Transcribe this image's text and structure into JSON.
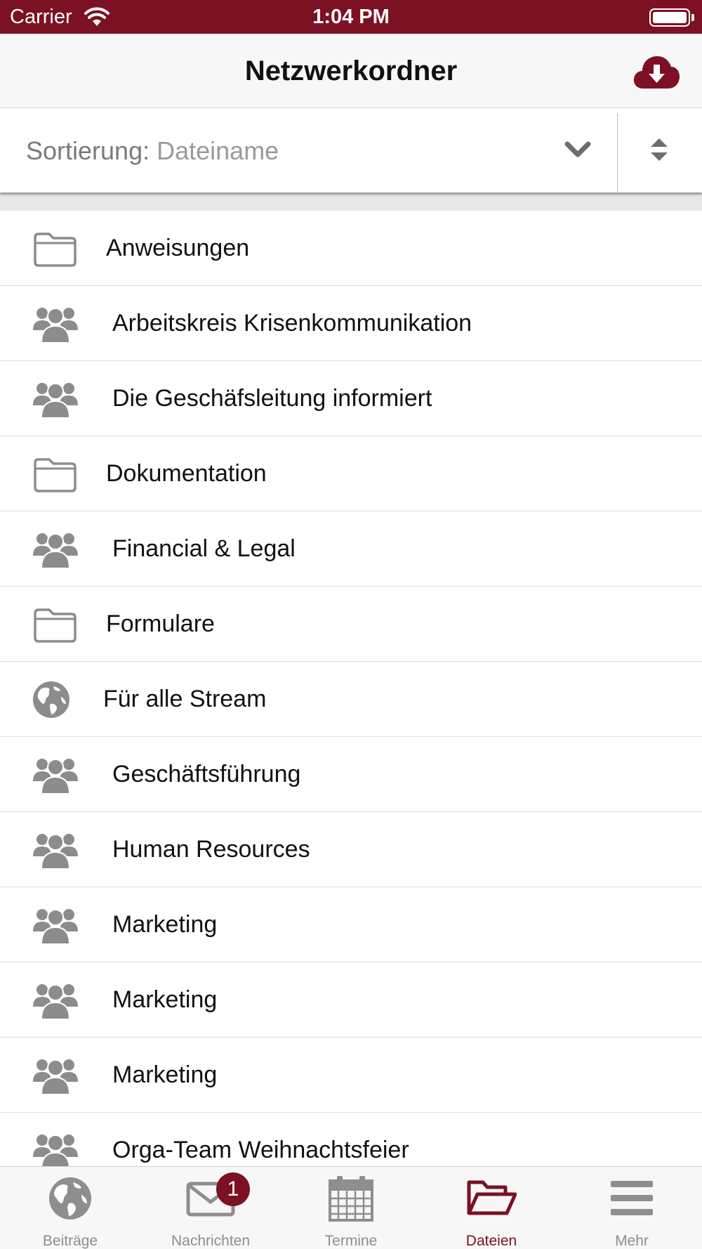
{
  "status_bar": {
    "carrier": "Carrier",
    "time": "1:04 PM"
  },
  "nav": {
    "title": "Netzwerkordner",
    "action_icon": "cloud-download-icon"
  },
  "sort": {
    "label": "Sortierung: ",
    "value": "Dateiname"
  },
  "items": [
    {
      "label": "Anweisungen",
      "icon": "folder-icon"
    },
    {
      "label": "Arbeitskreis Krisenkommunikation",
      "icon": "group-icon"
    },
    {
      "label": "Die Geschäfsleitung informiert",
      "icon": "group-icon"
    },
    {
      "label": "Dokumentation",
      "icon": "folder-icon"
    },
    {
      "label": "Financial & Legal",
      "icon": "group-icon"
    },
    {
      "label": "Formulare",
      "icon": "folder-icon"
    },
    {
      "label": "Für alle Stream",
      "icon": "globe-icon"
    },
    {
      "label": "Geschäftsführung",
      "icon": "group-icon"
    },
    {
      "label": "Human Resources",
      "icon": "group-icon"
    },
    {
      "label": "Marketing",
      "icon": "group-icon"
    },
    {
      "label": "Marketing",
      "icon": "group-icon"
    },
    {
      "label": "Marketing",
      "icon": "group-icon"
    },
    {
      "label": "Orga-Team Weihnachtsfeier",
      "icon": "group-icon"
    }
  ],
  "tabs": [
    {
      "label": "Beiträge",
      "icon": "globe-icon",
      "active": false
    },
    {
      "label": "Nachrichten",
      "icon": "envelope-icon",
      "active": false,
      "badge": "1"
    },
    {
      "label": "Termine",
      "icon": "calendar-icon",
      "active": false
    },
    {
      "label": "Dateien",
      "icon": "folder-open-icon",
      "active": true
    },
    {
      "label": "Mehr",
      "icon": "menu-icon",
      "active": false
    }
  ],
  "colors": {
    "brand": "#7b1123",
    "icon_gray": "#8c8c8c",
    "separator": "#dcdcdc"
  }
}
